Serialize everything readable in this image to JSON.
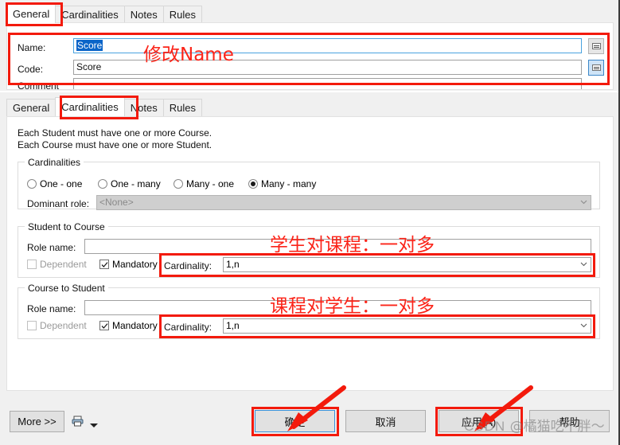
{
  "top_panel": {
    "tabs": [
      {
        "label": "General",
        "active": true
      },
      {
        "label": "Cardinalities",
        "active": false
      },
      {
        "label": "Notes",
        "active": false
      },
      {
        "label": "Rules",
        "active": false
      }
    ],
    "name_label": "Name:",
    "name_value": "Score",
    "code_label": "Code:",
    "code_value": "Score",
    "comment_label": "Comment",
    "name_button_icon": "equals-button-icon",
    "code_button_icon": "equals-button-icon"
  },
  "bottom_panel": {
    "tabs": [
      {
        "label": "General",
        "active": false
      },
      {
        "label": "Cardinalities",
        "active": true
      },
      {
        "label": "Notes",
        "active": false
      },
      {
        "label": "Rules",
        "active": false
      }
    ],
    "summary_line_1": "Each Student must have one or more Course.",
    "summary_line_2": "Each Course must have one or more Student.",
    "cardinalities_group": {
      "title": "Cardinalities",
      "options": [
        {
          "label": "One - one",
          "checked": false
        },
        {
          "label": "One - many",
          "checked": false
        },
        {
          "label": "Many - one",
          "checked": false
        },
        {
          "label": "Many - many",
          "checked": true
        }
      ],
      "dominant_role_label": "Dominant role:",
      "dominant_role_value": "<None>"
    },
    "student_to_course": {
      "title": "Student to Course",
      "role_name_label": "Role name:",
      "role_name_value": "",
      "dependent_label": "Dependent",
      "dependent_checked": false,
      "mandatory_label": "Mandatory",
      "mandatory_checked": true,
      "cardinality_label": "Cardinality:",
      "cardinality_value": "1,n"
    },
    "course_to_student": {
      "title": "Course to Student",
      "role_name_label": "Role name:",
      "role_name_value": "",
      "dependent_label": "Dependent",
      "dependent_checked": false,
      "mandatory_label": "Mandatory",
      "mandatory_checked": true,
      "cardinality_label": "Cardinality:",
      "cardinality_value": "1,n"
    },
    "footer": {
      "more_label": "More >>",
      "print_icon": "printer-icon",
      "print_dropdown_icon": "chevron-down-icon",
      "ok_label": "确定",
      "cancel_label": "取消",
      "apply_label": "应用(A)",
      "help_label": "帮助"
    }
  },
  "annotations": {
    "modify_name": "修改Name",
    "student_to_course_note": "学生对课程：一对多",
    "course_to_student_note": "课程对学生：一对多",
    "accent_red": "#f31a0c"
  },
  "watermark": {
    "brand": "CSDN",
    "handle": "@橘猫吃不胖～"
  }
}
